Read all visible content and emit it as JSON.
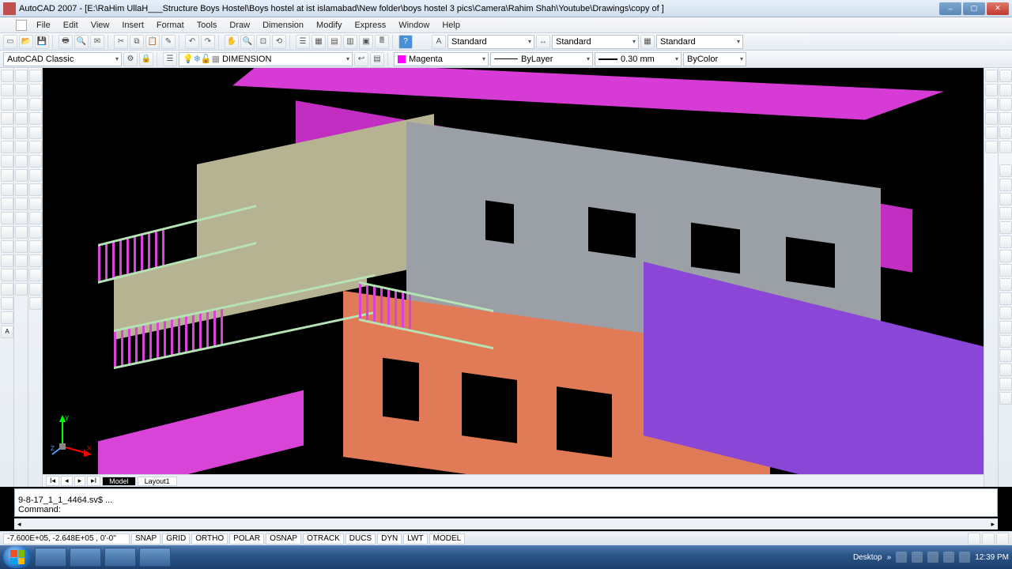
{
  "titlebar": {
    "app": "AutoCAD 2007",
    "doc": "[E:\\RaHim UllaH___Structure Boys Hostel\\Boys hostel at ist islamabad\\New folder\\boys hostel 3 pics\\Camera\\Rahim Shah\\Youtube\\Drawings\\copy of ]"
  },
  "menu": [
    "File",
    "Edit",
    "View",
    "Insert",
    "Format",
    "Tools",
    "Draw",
    "Dimension",
    "Modify",
    "Express",
    "Window",
    "Help"
  ],
  "toolbar2": {
    "workspace": "AutoCAD Classic",
    "layer": "DIMENSION",
    "color": "Magenta",
    "linetype": "ByLayer",
    "lineweight": "0.30 mm",
    "plotstyle": "ByColor",
    "textstyle1": "Standard",
    "textstyle2": "Standard",
    "textstyle3": "Standard"
  },
  "model_tabs": {
    "tab1": "Model",
    "tab2": "Layout1"
  },
  "command": {
    "history": "9-8-17_1_1_4464.sv$ ...",
    "prompt": "Command:"
  },
  "statusbar": {
    "coords": "-7.600E+05, -2.648E+05 , 0'-0\"",
    "toggles": [
      "SNAP",
      "GRID",
      "ORTHO",
      "POLAR",
      "OSNAP",
      "OTRACK",
      "DUCS",
      "DYN",
      "LWT",
      "MODEL"
    ]
  },
  "taskbar": {
    "desktop": "Desktop",
    "time": "12:39 PM"
  }
}
